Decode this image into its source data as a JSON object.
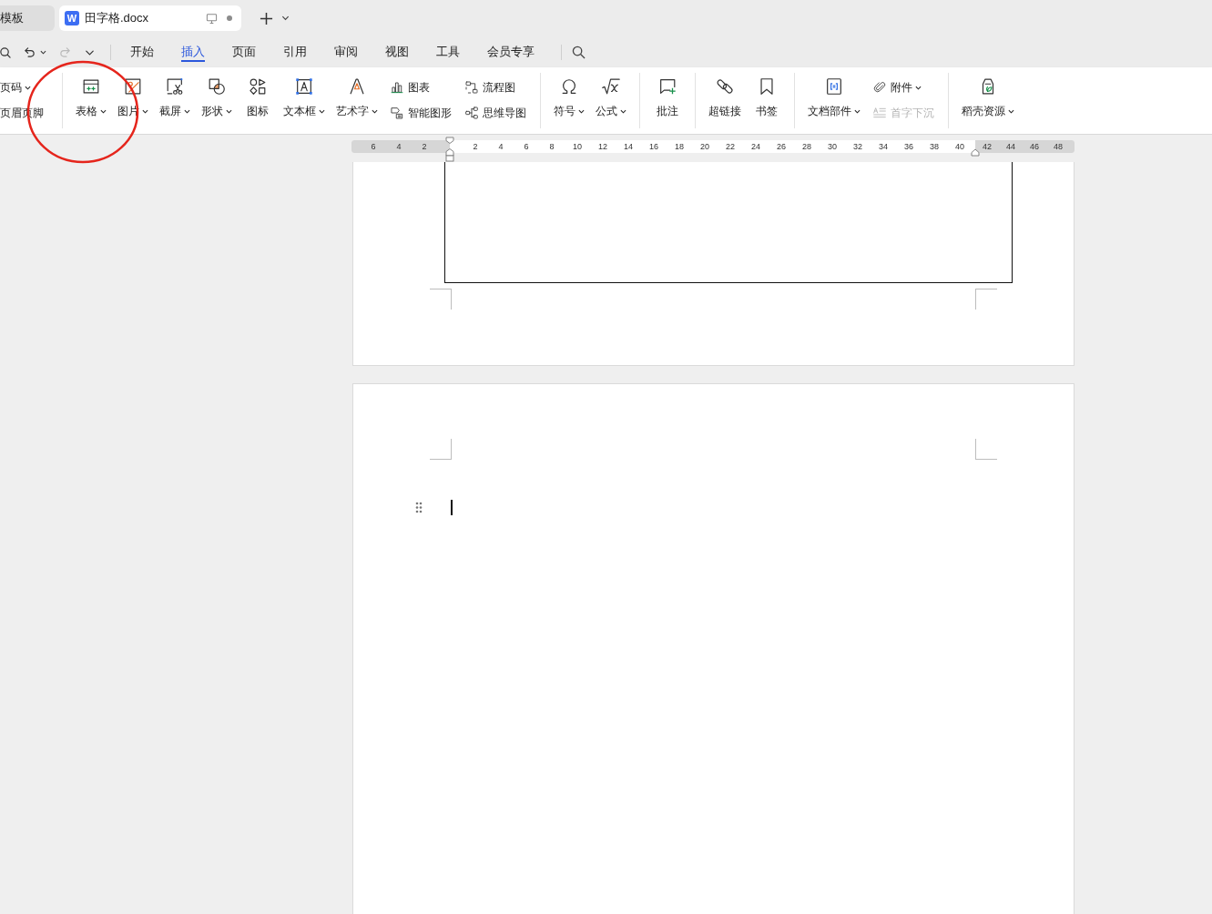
{
  "tab_bar": {
    "tabs": [
      {
        "kind": "template",
        "title": "模板",
        "selected": false,
        "modified": false
      },
      {
        "kind": "document",
        "badge": "W",
        "title": "田字格.docx",
        "selected": true,
        "modified": true
      }
    ]
  },
  "quick_access": [
    {
      "kind": "preview",
      "disabled": false,
      "dropdown": false
    },
    {
      "kind": "undo",
      "disabled": false,
      "dropdown": true
    },
    {
      "kind": "redo",
      "disabled": true,
      "dropdown": false
    },
    {
      "kind": "more",
      "disabled": false,
      "dropdown": false
    }
  ],
  "menu_tabs": [
    {
      "label": "开始",
      "selected": false
    },
    {
      "label": "插入",
      "selected": true
    },
    {
      "label": "页面",
      "selected": false
    },
    {
      "label": "引用",
      "selected": false
    },
    {
      "label": "审阅",
      "selected": false
    },
    {
      "label": "视图",
      "selected": false
    },
    {
      "label": "工具",
      "selected": false
    },
    {
      "label": "会员专享",
      "selected": false
    }
  ],
  "ribbon": {
    "groups": [
      {
        "columns": [
          {
            "kind": "stack",
            "entries": [
              {
                "label": "页码",
                "dropdown": true,
                "disabled": false
              },
              {
                "label": "页眉页脚",
                "dropdown": false,
                "disabled": false
              }
            ]
          }
        ]
      },
      {
        "columns": [
          {
            "kind": "large",
            "label": "表格",
            "dropdown": true,
            "disabled": false
          },
          {
            "kind": "large",
            "label": "图片",
            "dropdown": true,
            "disabled": false
          },
          {
            "kind": "large",
            "label": "截屏",
            "dropdown": true,
            "disabled": false
          },
          {
            "kind": "large",
            "label": "形状",
            "dropdown": true,
            "disabled": false
          },
          {
            "kind": "large",
            "label": "图标",
            "dropdown": false,
            "disabled": false
          },
          {
            "kind": "large",
            "label": "文本框",
            "dropdown": true,
            "disabled": false
          },
          {
            "kind": "large",
            "label": "艺术字",
            "dropdown": true,
            "disabled": false
          },
          {
            "kind": "stack",
            "entries": [
              {
                "label": "图表",
                "dropdown": false,
                "disabled": false
              },
              {
                "label": "智能图形",
                "dropdown": false,
                "disabled": false
              }
            ]
          },
          {
            "kind": "stack",
            "entries": [
              {
                "label": "流程图",
                "dropdown": false,
                "disabled": false
              },
              {
                "label": "思维导图",
                "dropdown": false,
                "disabled": false
              }
            ]
          }
        ]
      },
      {
        "columns": [
          {
            "kind": "large",
            "label": "符号",
            "dropdown": true,
            "disabled": false
          },
          {
            "kind": "large",
            "label": "公式",
            "dropdown": true,
            "disabled": false
          }
        ]
      },
      {
        "columns": [
          {
            "kind": "large",
            "label": "批注",
            "dropdown": false,
            "disabled": false
          }
        ]
      },
      {
        "columns": [
          {
            "kind": "large",
            "label": "超链接",
            "dropdown": false,
            "disabled": false
          },
          {
            "kind": "large",
            "label": "书签",
            "dropdown": false,
            "disabled": false
          }
        ]
      },
      {
        "columns": [
          {
            "kind": "large",
            "label": "文档部件",
            "dropdown": true,
            "disabled": false
          },
          {
            "kind": "stack",
            "entries": [
              {
                "label": "附件",
                "dropdown": true,
                "disabled": false
              },
              {
                "label": "首字下沉",
                "dropdown": false,
                "disabled": true
              }
            ]
          }
        ]
      },
      {
        "columns": [
          {
            "kind": "large",
            "label": "稻壳资源",
            "dropdown": true,
            "disabled": false
          }
        ]
      }
    ]
  },
  "ruler": {
    "left_labels": [
      "6",
      "4",
      "2"
    ],
    "labels": [
      "2",
      "4",
      "6",
      "8",
      "10",
      "12",
      "14",
      "16",
      "18",
      "20",
      "22",
      "24",
      "26",
      "28",
      "30",
      "32",
      "34",
      "36",
      "38",
      "40"
    ],
    "right_labels": [
      "42",
      "44",
      "46",
      "48"
    ]
  },
  "document": {
    "pages": [
      {
        "kind": "table_end"
      },
      {
        "kind": "text_cursor"
      }
    ]
  }
}
